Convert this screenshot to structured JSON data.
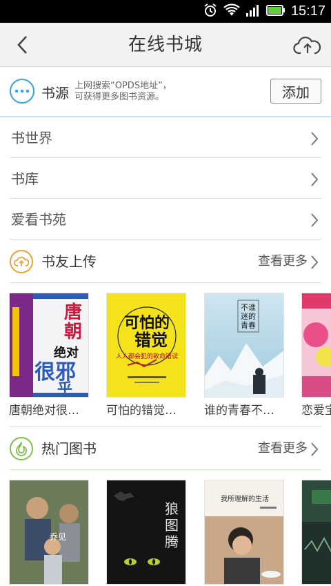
{
  "status_bar": {
    "time": "15:17"
  },
  "header": {
    "title": "在线书城"
  },
  "source": {
    "title": "书源",
    "description_line1": "上网搜索“OPDS地址”，",
    "description_line2": "可获得更多图书资源。",
    "add_label": "添加"
  },
  "menu": {
    "items": [
      {
        "label": "书世界"
      },
      {
        "label": "书库"
      },
      {
        "label": "爱看书苑"
      }
    ]
  },
  "uploads": {
    "title": "书友上传",
    "more_label": "查看更多",
    "books": [
      {
        "title": "唐朝绝对很…",
        "cover_text": "唐朝绝对很邪乎"
      },
      {
        "title": "可怕的错觉…",
        "cover_text": "可怕的错觉"
      },
      {
        "title": "谁的青春不…",
        "cover_text": "不谁迷的青春"
      },
      {
        "title": "恋爱宝"
      }
    ]
  },
  "popular": {
    "title": "热门图书",
    "more_label": "查看更多",
    "books": [
      {
        "cover_text": "乔见"
      },
      {
        "cover_text": "狼图腾"
      },
      {
        "cover_text": "我所理解的生活"
      },
      {
        "cover_text": ""
      }
    ]
  },
  "colors": {
    "accent_blue": "#2aa8df",
    "upload_orange": "#f0a030",
    "popular_green": "#7cc04a"
  }
}
